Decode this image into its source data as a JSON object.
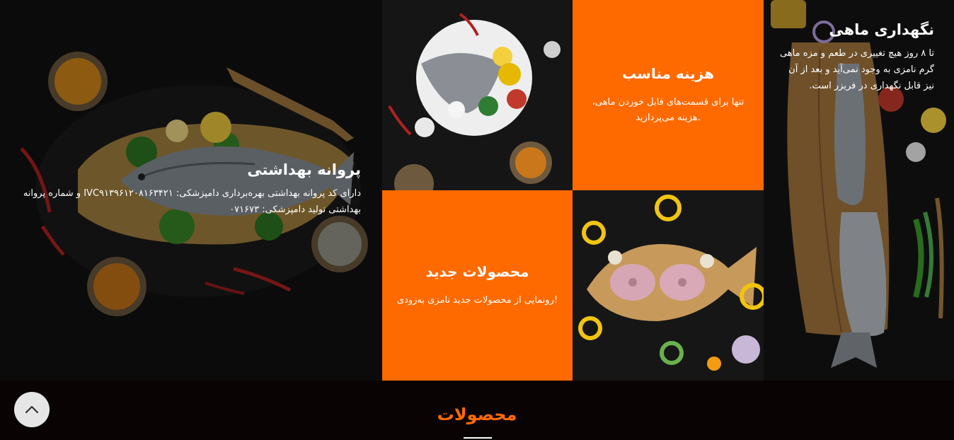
{
  "features": [
    {
      "title": "نگهداری ماهی",
      "text": "تا ۸ روز هیچ تغییری در طعم و مزه ماهی گرم نامزی به وجود نمی‌آید و بعد از آن نیز قابل نگهداری در فریزر است."
    },
    {
      "title": "هزینه مناسب",
      "text": "تنها برای قسمت‌های قابل خوردن ماهی، هزینه می‌پردازید."
    },
    {
      "title": "پروانه بهداشتی",
      "text": "دارای کد پروانه بهداشتی بهره‌برداری دامپزشکی: IVC۹۱۳۹۶۱۲۰۸۱۶۳۴۲۱ و شماره پروانه بهداشتی تولید دامپزشکی: ۰۷۱۶۷۳"
    },
    {
      "title": "محصولات جدید",
      "text": "رونمایی از محصولات جدید نامزی به‌زودی!"
    }
  ],
  "section": {
    "title": "محصولات"
  },
  "icons": {
    "scroll_top": "chevron-up-icon"
  },
  "colors": {
    "accent": "#ff6a00",
    "background": "#0a0303"
  }
}
